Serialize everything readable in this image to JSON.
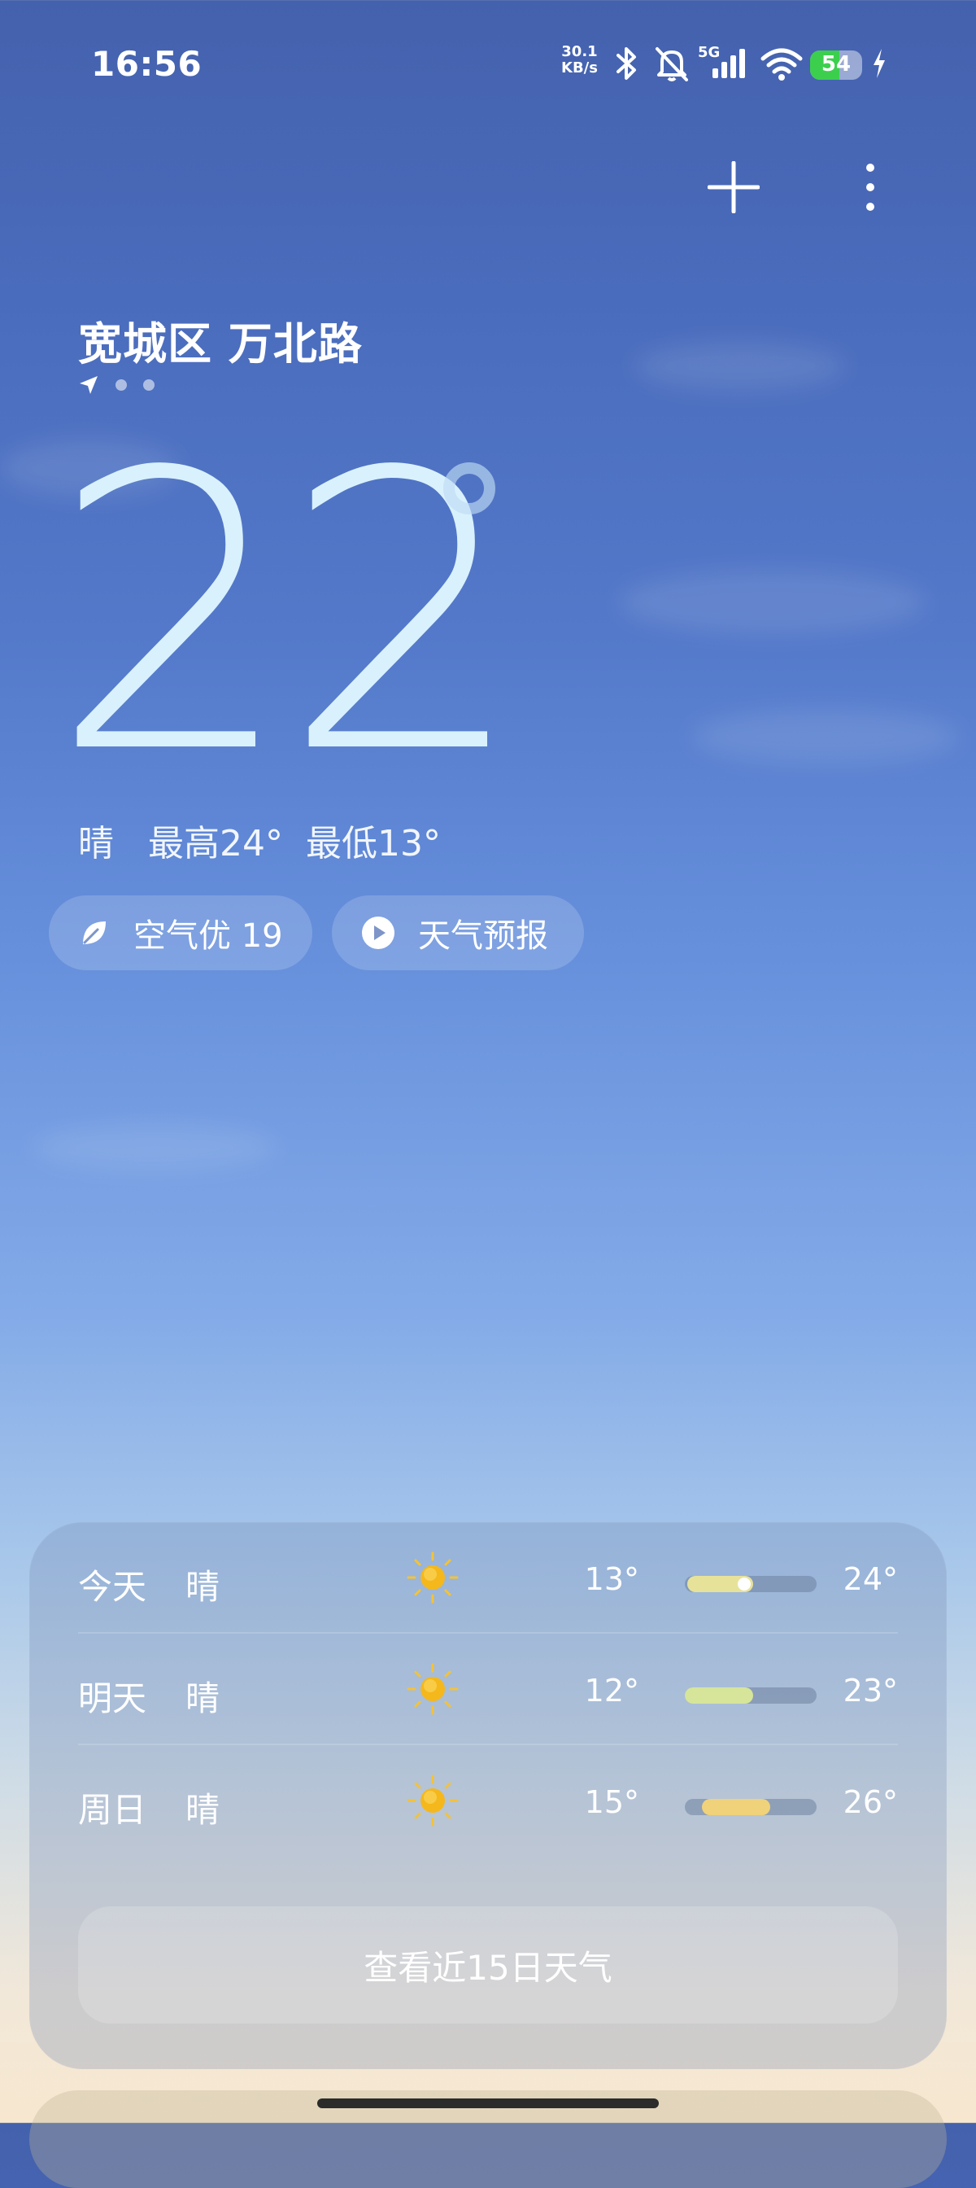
{
  "status_bar": {
    "time": "16:56",
    "net_speed_value": "30.1",
    "net_speed_unit": "KB/s",
    "network_type": "5G",
    "battery_level": "54",
    "icons": [
      "bluetooth-icon",
      "mute-icon",
      "signal-icon",
      "wifi-icon",
      "battery-icon",
      "charging-icon"
    ]
  },
  "header": {
    "add_icon": "plus-icon",
    "menu_icon": "more-vertical-icon"
  },
  "location": {
    "name": "宽城区 万北路",
    "page_count": 3,
    "current_page_indicator": "location-arrow-icon"
  },
  "current": {
    "temperature": "22",
    "condition": "晴",
    "high": "最高24°",
    "low": "最低13°"
  },
  "chips": {
    "air_quality": "空气优 19",
    "forecast_video": "天气预报"
  },
  "forecast": {
    "rows": [
      {
        "day": "今天",
        "condition": "晴",
        "low": "13°",
        "high": "24°",
        "range_start": 0.02,
        "range_end": 0.52,
        "current_marker": 0.45,
        "color": "#e7e29a"
      },
      {
        "day": "明天",
        "condition": "晴",
        "low": "12°",
        "high": "23°",
        "range_start": 0.0,
        "range_end": 0.52,
        "current_marker": null,
        "color": "#d6e59a"
      },
      {
        "day": "周日",
        "condition": "晴",
        "low": "15°",
        "high": "26°",
        "range_start": 0.13,
        "range_end": 0.65,
        "current_marker": null,
        "color": "#f0d27a"
      }
    ],
    "more_button": "查看近15日天气"
  },
  "colors": {
    "sky_top": "#4461ad",
    "sky_bottom": "#f7e7cf",
    "temperature_text": "#d9f1fc",
    "sun": "#f4b81c"
  }
}
